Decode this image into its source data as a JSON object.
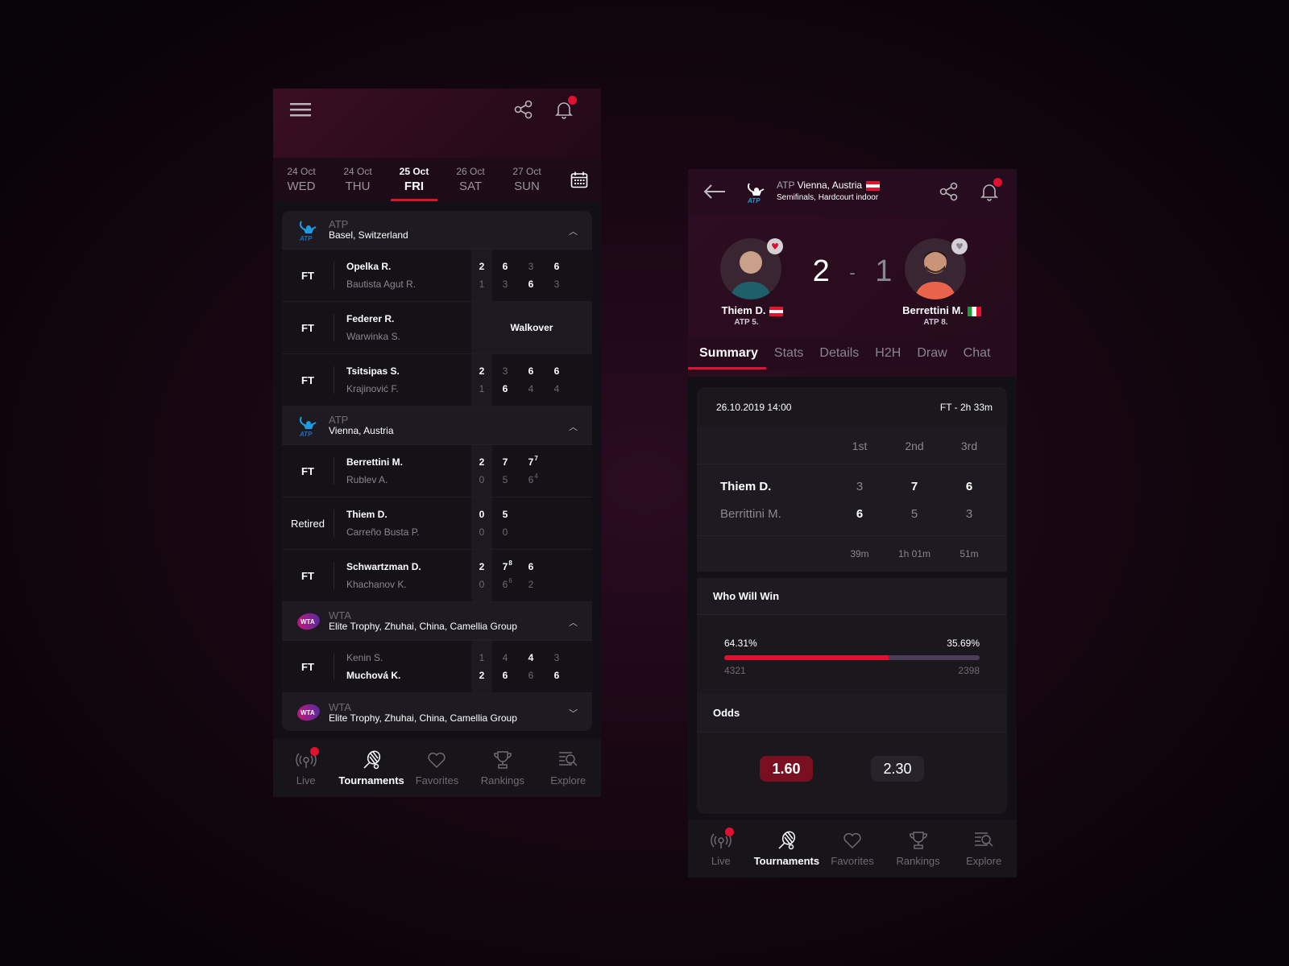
{
  "left_screen": {
    "header": {
      "menu_icon": "hamburger-icon",
      "share_icon": "share-icon",
      "bell_icon": "bell-icon"
    },
    "dates": [
      {
        "day": "24 Oct",
        "weekday": "WED",
        "active": false
      },
      {
        "day": "24 Oct",
        "weekday": "THU",
        "active": false
      },
      {
        "day": "25 Oct",
        "weekday": "FRI",
        "active": true
      },
      {
        "day": "26 Oct",
        "weekday": "SAT",
        "active": false
      },
      {
        "day": "27 Oct",
        "weekday": "SUN",
        "active": false
      }
    ],
    "tournaments": [
      {
        "tour": "ATP",
        "name": "Basel, Switzerland",
        "expanded": true,
        "matches": [
          {
            "status": "FT",
            "p1": "Opelka R.",
            "p2": "Bautista Agut R.",
            "sets": [
              "2",
              "1"
            ],
            "games": [
              [
                "6",
                "3"
              ],
              [
                "3",
                "6"
              ],
              [
                "6",
                "3"
              ]
            ]
          },
          {
            "status": "FT",
            "p1": "Federer R.",
            "p2": "Warwinka S.",
            "result": "Walkover"
          },
          {
            "status": "FT",
            "p1": "Tsitsipas S.",
            "p2": "Krajinović F.",
            "sets": [
              "2",
              "1"
            ],
            "games": [
              [
                "3",
                "6"
              ],
              [
                "6",
                "4"
              ],
              [
                "6",
                "4"
              ]
            ]
          }
        ]
      },
      {
        "tour": "ATP",
        "name": "Vienna, Austria",
        "expanded": true,
        "matches": [
          {
            "status": "FT",
            "p1": "Berrettini M.",
            "p2": "Rublev A.",
            "sets": [
              "2",
              "0"
            ],
            "games": [
              [
                "7",
                "5"
              ],
              [
                "7",
                "6"
              ]
            ],
            "tiebreak": {
              "p1": "7",
              "p2": "4"
            }
          },
          {
            "status": "Retired",
            "p1": "Thiem D.",
            "p2": "Carreño Busta P.",
            "sets": [
              "0",
              "0"
            ],
            "games": [
              [
                "5",
                "0"
              ]
            ]
          },
          {
            "status": "FT",
            "p1": "Schwartzman D.",
            "p2": "Khachanov K.",
            "sets": [
              "2",
              "0"
            ],
            "games": [
              [
                "7",
                "6"
              ],
              [
                "6",
                "2"
              ]
            ],
            "tiebreak": {
              "p1": "8",
              "p2": "6"
            }
          }
        ]
      },
      {
        "tour": "WTA",
        "name": "Elite Trophy, Zhuhai, China, Camellia Group",
        "expanded": true,
        "matches": [
          {
            "status": "FT",
            "p1": "Kenin S.",
            "p2": "Muchová K.",
            "sets": [
              "1",
              "2"
            ],
            "games": [
              [
                "4",
                "6"
              ],
              [
                "4",
                "6"
              ],
              [
                "3",
                "6"
              ]
            ]
          }
        ]
      },
      {
        "tour": "WTA",
        "name": "Elite Trophy, Zhuhai, China, Camellia Group",
        "expanded": false
      }
    ],
    "nav": [
      {
        "label": "Live",
        "icon": "live-broadcast-icon",
        "active": false
      },
      {
        "label": "Tournaments",
        "icon": "tennis-racket-icon",
        "active": true
      },
      {
        "label": "Favorites",
        "icon": "heart-icon",
        "active": false
      },
      {
        "label": "Rankings",
        "icon": "trophy-icon",
        "active": false
      },
      {
        "label": "Explore",
        "icon": "explore-search-icon",
        "active": false
      }
    ]
  },
  "right_screen": {
    "header": {
      "tour": "ATP",
      "tournament": "Vienna, Austria",
      "round": "Semifinals,",
      "surface": "Hardcourt indoor"
    },
    "player1": {
      "name": "Thiem D.",
      "rank": "ATP 5.",
      "favorite": true
    },
    "player2": {
      "name": "Berrettini  M.",
      "rank": "ATP 8.",
      "favorite": false
    },
    "score": {
      "p1": "2",
      "sep": "-",
      "p2": "1"
    },
    "tabs": [
      "Summary",
      "Stats",
      "Details",
      "H2H",
      "Draw",
      "Chat"
    ],
    "summary": {
      "datetime": "26.10.2019 14:00",
      "status": "FT - 2h 33m",
      "set_headers": [
        "1st",
        "2nd",
        "3rd"
      ],
      "rows": [
        {
          "name": "Thiem D.",
          "scores": [
            "3",
            "7",
            "6"
          ]
        },
        {
          "name": "Berrittini M.",
          "scores": [
            "6",
            "5",
            "3"
          ]
        }
      ],
      "durations": [
        "39m",
        "1h 01m",
        "51m"
      ]
    },
    "who_will_win": {
      "title": "Who Will Win",
      "p1_pct": "64.31%",
      "p2_pct": "35.69%",
      "p1_fraction": 0.6431,
      "p1_votes": "4321",
      "p2_votes": "2398"
    },
    "odds": {
      "title": "Odds",
      "p1": "1.60",
      "p2": "2.30"
    },
    "nav": [
      {
        "label": "Live"
      },
      {
        "label": "Tournaments"
      },
      {
        "label": "Favorites"
      },
      {
        "label": "Rankings"
      },
      {
        "label": "Explore"
      }
    ]
  },
  "colors": {
    "accent": "#e0102e",
    "odds_selected": "#7a0f22",
    "bar_rest": "#4a3d57"
  }
}
